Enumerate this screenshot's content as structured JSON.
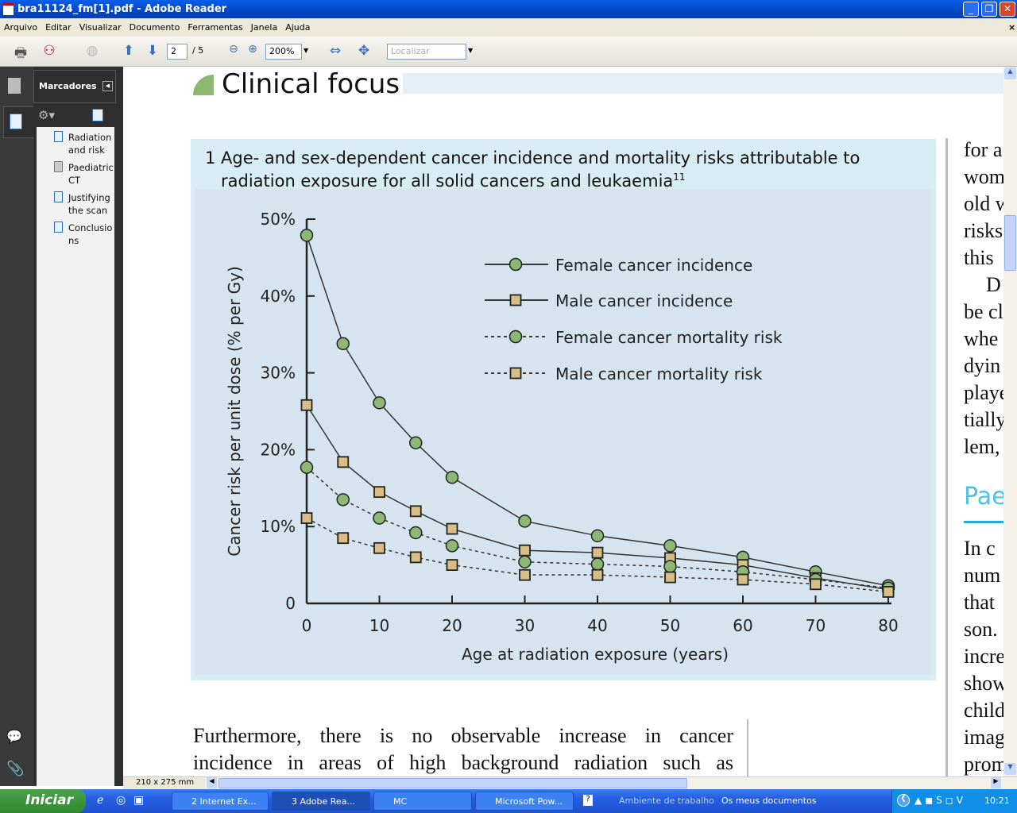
{
  "window": {
    "title": "bra11124_fm[1].pdf - Adobe Reader"
  },
  "menu": [
    "Arquivo",
    "Editar",
    "Visualizar",
    "Documento",
    "Ferramentas",
    "Janela",
    "Ajuda"
  ],
  "toolbar": {
    "page_current": "2",
    "page_total": "/ 5",
    "zoom": "200%",
    "search_placeholder": "Localizar"
  },
  "sidebar": {
    "title": "Marcadores",
    "bookmarks": [
      {
        "label": "Radiation and risk"
      },
      {
        "label": "Paediatric CT"
      },
      {
        "label": "Justifying the scan"
      },
      {
        "label": "Conclusions"
      }
    ]
  },
  "document": {
    "section_title": "Clinical focus",
    "figure_number": "1",
    "figure_title": "Age- and sex-dependent cancer incidence and mortality risks attributable to radiation exposure for all solid cancers and leukaemia",
    "figure_ref": "11",
    "body_lines": [
      "Furthermore, there is no observable increase in cancer",
      "incidence in areas of high background radiation such as"
    ],
    "right_column_lines": [
      "for a",
      "wom",
      "old w",
      "risks",
      "this",
      "D",
      "be cl",
      "whe",
      "dyin",
      "playe",
      "tially",
      "lem,"
    ],
    "right_heading": "Pae",
    "right_column_lines2": [
      "In c",
      "num",
      "that",
      "son.",
      "incre",
      "show",
      "child",
      "imag",
      "prom"
    ]
  },
  "page_size": "210 x 275 mm",
  "chart_data": {
    "type": "line",
    "title": "",
    "xlabel": "Age at radiation exposure (years)",
    "ylabel": "Cancer risk per unit dose (% per Gy)",
    "x": [
      0,
      5,
      10,
      15,
      20,
      30,
      40,
      50,
      60,
      70,
      80
    ],
    "xticks": [
      "0",
      "10",
      "20",
      "30",
      "40",
      "50",
      "60",
      "70",
      "80"
    ],
    "yticks": [
      "0",
      "10%",
      "20%",
      "30%",
      "40%",
      "50%"
    ],
    "xlim": [
      0,
      80
    ],
    "ylim": [
      0,
      50
    ],
    "grid": false,
    "legend": "top-right",
    "series": [
      {
        "name": "Female cancer incidence",
        "style": "solid",
        "marker": "circle",
        "color": "#8db873",
        "values": [
          47.9,
          33.8,
          26.1,
          20.9,
          16.4,
          10.7,
          8.8,
          7.5,
          6.0,
          4.1,
          2.3
        ]
      },
      {
        "name": "Male cancer incidence",
        "style": "solid",
        "marker": "square",
        "color": "#d9bd86",
        "values": [
          25.8,
          18.4,
          14.5,
          12.0,
          9.7,
          6.9,
          6.6,
          5.9,
          5.0,
          3.3,
          1.8
        ]
      },
      {
        "name": "Female cancer mortality risk",
        "style": "dashed",
        "marker": "circle",
        "color": "#8db873",
        "values": [
          17.7,
          13.5,
          11.1,
          9.2,
          7.5,
          5.4,
          5.1,
          4.8,
          4.1,
          3.1,
          2.0
        ]
      },
      {
        "name": "Male cancer mortality risk",
        "style": "dashed",
        "marker": "square",
        "color": "#d9bd86",
        "values": [
          11.1,
          8.5,
          7.2,
          6.0,
          5.0,
          3.7,
          3.7,
          3.4,
          3.1,
          2.5,
          1.5
        ]
      }
    ]
  },
  "taskbar": {
    "start": "Iniciar",
    "tasks": [
      "2 Internet Ex...",
      "3 Adobe Rea...",
      "MC",
      "Microsoft Pow..."
    ],
    "quicklinks": [
      "Ambiente de trabalho",
      "Os meus documentos"
    ],
    "clock": "10:21"
  }
}
